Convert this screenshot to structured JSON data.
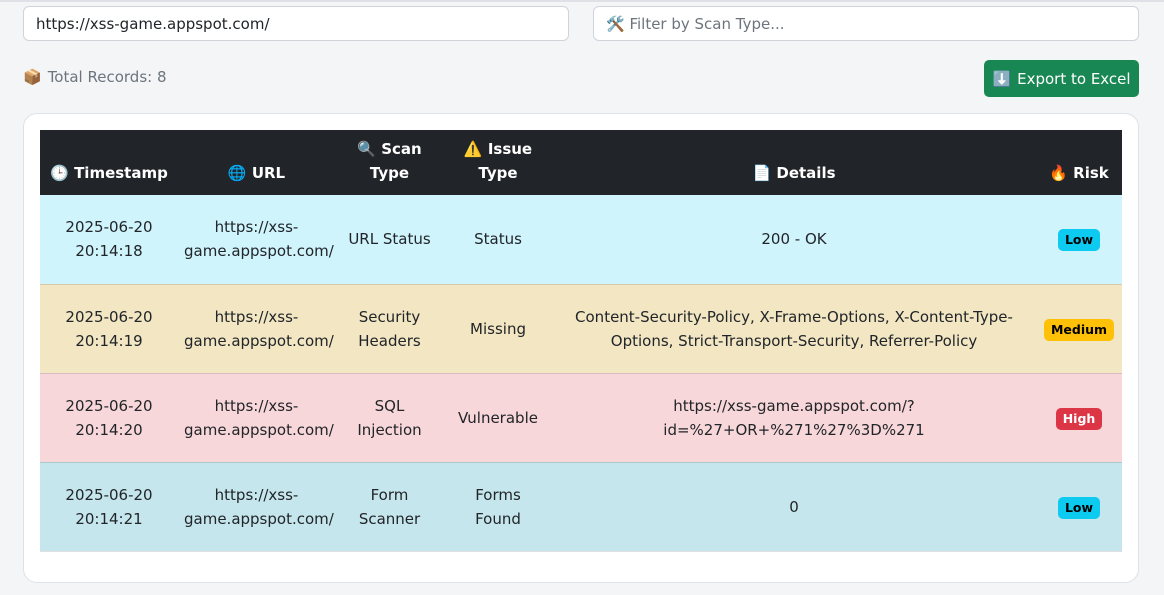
{
  "url_input": {
    "value": "https://xss-game.appspot.com/"
  },
  "filter_input": {
    "placeholder": "🛠️ Filter by Scan Type..."
  },
  "summary": {
    "icon": "📦",
    "text": "Total Records: 8"
  },
  "export_button": {
    "icon": "⬇️",
    "label": "Export to Excel"
  },
  "table": {
    "columns": [
      {
        "icon": "🕒",
        "label": "Timestamp"
      },
      {
        "icon": "🌐",
        "label": "URL"
      },
      {
        "icon": "🔍",
        "label": "Scan Type"
      },
      {
        "icon": "⚠️",
        "label": "Issue Type"
      },
      {
        "icon": "📄",
        "label": "Details"
      },
      {
        "icon": "🔥",
        "label": "Risk"
      }
    ],
    "rows": [
      {
        "timestamp": "2025-06-20 20:14:18",
        "url": "https://xss-game.appspot.com/",
        "scan_type": "URL Status",
        "issue_type": "Status",
        "details": "200 - OK",
        "risk": "Low",
        "row_color": "#cff4fc",
        "risk_color": "#0dcaf0",
        "risk_text_color": "#000000"
      },
      {
        "timestamp": "2025-06-20 20:14:19",
        "url": "https://xss-game.appspot.com/",
        "scan_type": "Security Headers",
        "issue_type": "Missing",
        "details": "Content-Security-Policy, X-Frame-Options, X-Content-Type-Options, Strict-Transport-Security, Referrer-Policy",
        "risk": "Medium",
        "row_color": "#f2e6c3",
        "risk_color": "#ffc107",
        "risk_text_color": "#000000"
      },
      {
        "timestamp": "2025-06-20 20:14:20",
        "url": "https://xss-game.appspot.com/",
        "scan_type": "SQL Injection",
        "issue_type": "Vulnerable",
        "details": "https://xss-game.appspot.com/?id=%27+OR+%271%27%3D%271",
        "risk": "High",
        "row_color": "#f8d7da",
        "risk_color": "#dc3545",
        "risk_text_color": "#ffffff"
      },
      {
        "timestamp": "2025-06-20 20:14:21",
        "url": "https://xss-game.appspot.com/",
        "scan_type": "Form Scanner",
        "issue_type": "Forms Found",
        "details": "0",
        "risk": "Low",
        "row_color": "#c5e6ec",
        "risk_color": "#0dcaf0",
        "risk_text_color": "#000000"
      }
    ]
  }
}
